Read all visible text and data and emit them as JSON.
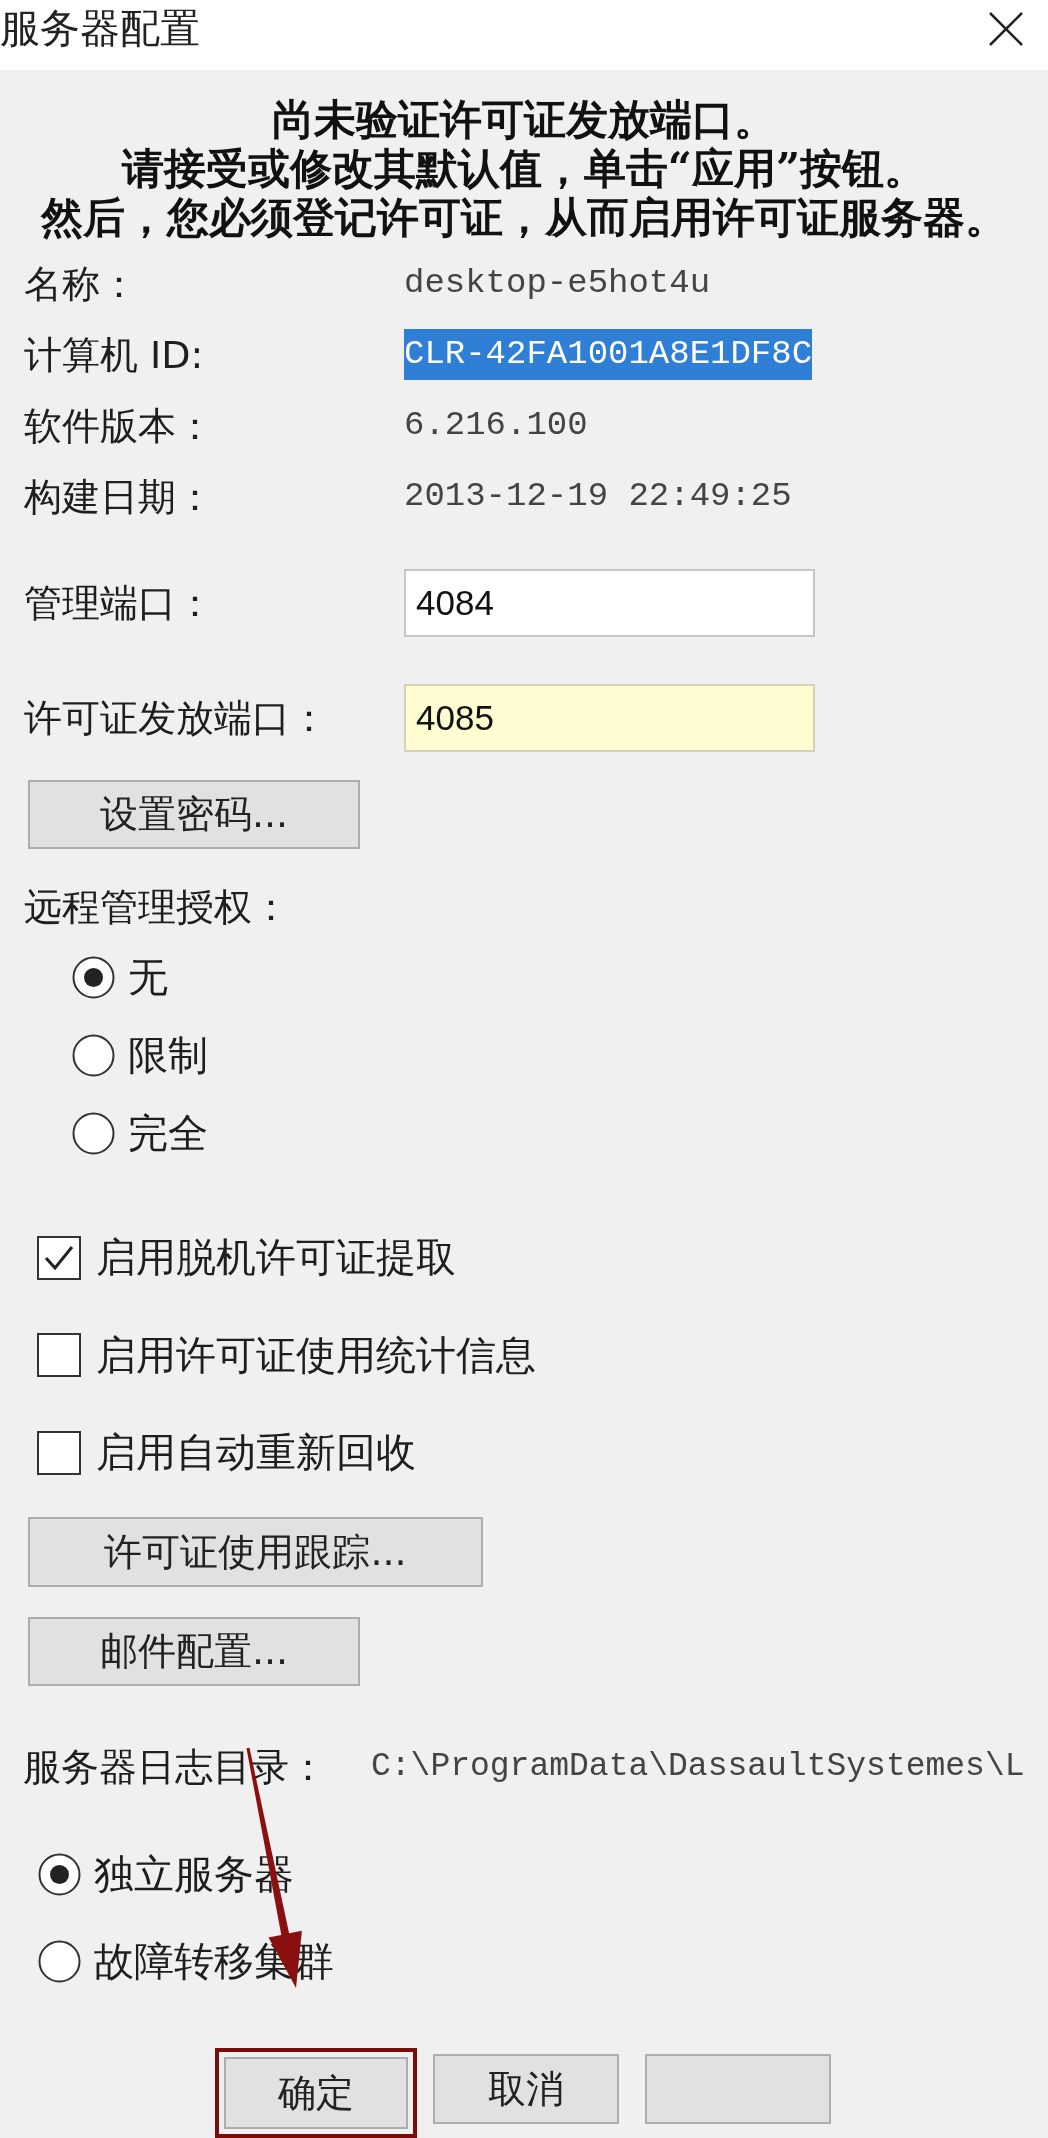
{
  "window": {
    "title": "服务器配置"
  },
  "message": [
    "尚未验证许可证发放端口。",
    "请接受或修改其默认值，单击“应用”按钮。",
    "然后，您必须登记许可证，从而启用许可证服务器。"
  ],
  "info": [
    {
      "label": "名称：",
      "value": "desktop-e5hot4u",
      "selected": false
    },
    {
      "label": "计算机 ID:",
      "value": "CLR-42FA1001A8E1DF8C",
      "selected": true
    },
    {
      "label": "软件版本：",
      "value": "6.216.100",
      "selected": false
    },
    {
      "label": "构建日期：",
      "value": "2013-12-19 22:49:25",
      "selected": false
    }
  ],
  "ports": [
    {
      "label": "管理端口：",
      "value": "4084",
      "highlighted": false
    },
    {
      "label": "许可证发放端口：",
      "value": "4085",
      "highlighted": true
    }
  ],
  "set_password_button": "设置密码...",
  "remote_admin": {
    "label": "远程管理授权：",
    "options": [
      {
        "label": "无",
        "selected": true
      },
      {
        "label": "限制",
        "selected": false
      },
      {
        "label": "完全",
        "selected": false
      }
    ]
  },
  "checkboxes": [
    {
      "label": "启用脱机许可证提取",
      "checked": true
    },
    {
      "label": "启用许可证使用统计信息",
      "checked": false
    },
    {
      "label": "启用自动重新回收",
      "checked": false
    }
  ],
  "tool_buttons": [
    "许可证使用跟踪...",
    "邮件配置..."
  ],
  "log_directory": {
    "label": "服务器日志目录：",
    "value": "C:\\ProgramData\\DassaultSystemes\\L"
  },
  "server_mode": [
    {
      "label": "独立服务器",
      "selected": true
    },
    {
      "label": "故障转移集群",
      "selected": false
    }
  ],
  "buttons": [
    {
      "label": "确定",
      "highlighted": true
    },
    {
      "label": "取消",
      "highlighted": false
    },
    {
      "highlighted": false
    }
  ],
  "annotations": [
    {
      "kind": "arrow"
    }
  ]
}
